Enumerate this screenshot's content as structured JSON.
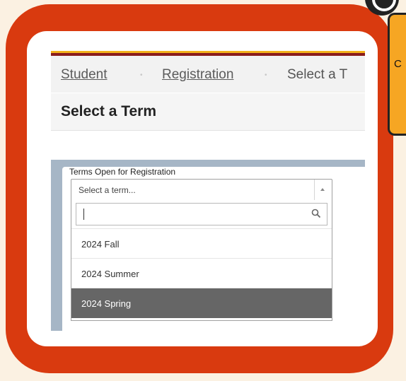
{
  "breadcrumb": {
    "items": [
      "Student",
      "Registration",
      "Select a T"
    ],
    "separator": "•"
  },
  "page": {
    "title": "Select a Term"
  },
  "terms_field": {
    "label": "Terms Open for Registration",
    "placeholder": "Select a term...",
    "search_value": "",
    "options": [
      "2024 Fall",
      "2024 Summer",
      "2024 Spring"
    ],
    "highlighted": "2024 Spring"
  },
  "callout": {
    "text": "C"
  },
  "colors": {
    "frame": "#d93a0f",
    "background": "#fbf1e2",
    "callout": "#f6a623",
    "accent_gold": "#f2b21b",
    "accent_maroon": "#8a1c1c",
    "panel_blue": "#a6b6c6",
    "highlight": "#666666"
  },
  "icons": {
    "search": "search-icon",
    "sort": "sort-arrow-icon"
  }
}
